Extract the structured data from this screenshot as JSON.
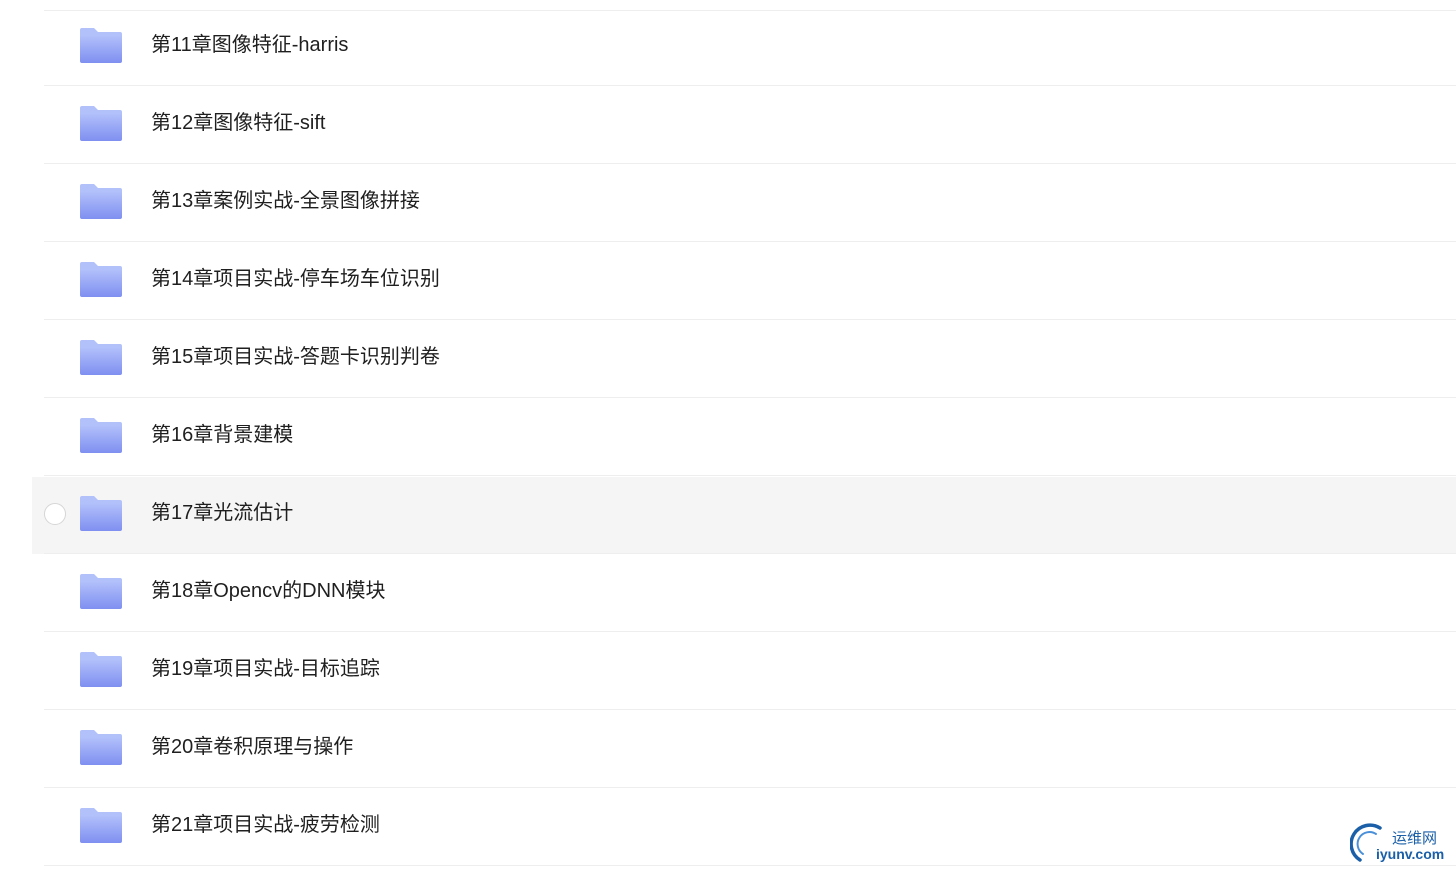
{
  "folders": [
    {
      "name": "第11章图像特征-harris"
    },
    {
      "name": "第12章图像特征-sift"
    },
    {
      "name": "第13章案例实战-全景图像拼接"
    },
    {
      "name": "第14章项目实战-停车场车位识别"
    },
    {
      "name": "第15章项目实战-答题卡识别判卷"
    },
    {
      "name": "第16章背景建模"
    },
    {
      "name": "第17章光流估计"
    },
    {
      "name": "第18章Opencv的DNN模块"
    },
    {
      "name": "第19章项目实战-目标追踪"
    },
    {
      "name": "第20章卷积原理与操作"
    },
    {
      "name": "第21章项目实战-疲劳检测"
    }
  ],
  "hovered_index": 6,
  "colors": {
    "folder_light": "#b3c1fb",
    "folder_dark": "#7f8ff0",
    "hover_bg": "#f5f5f5",
    "separator": "#eeeeee",
    "watermark": "#1a5fa8"
  },
  "watermark": {
    "cn": "运维网",
    "en": "iyunv.com"
  }
}
